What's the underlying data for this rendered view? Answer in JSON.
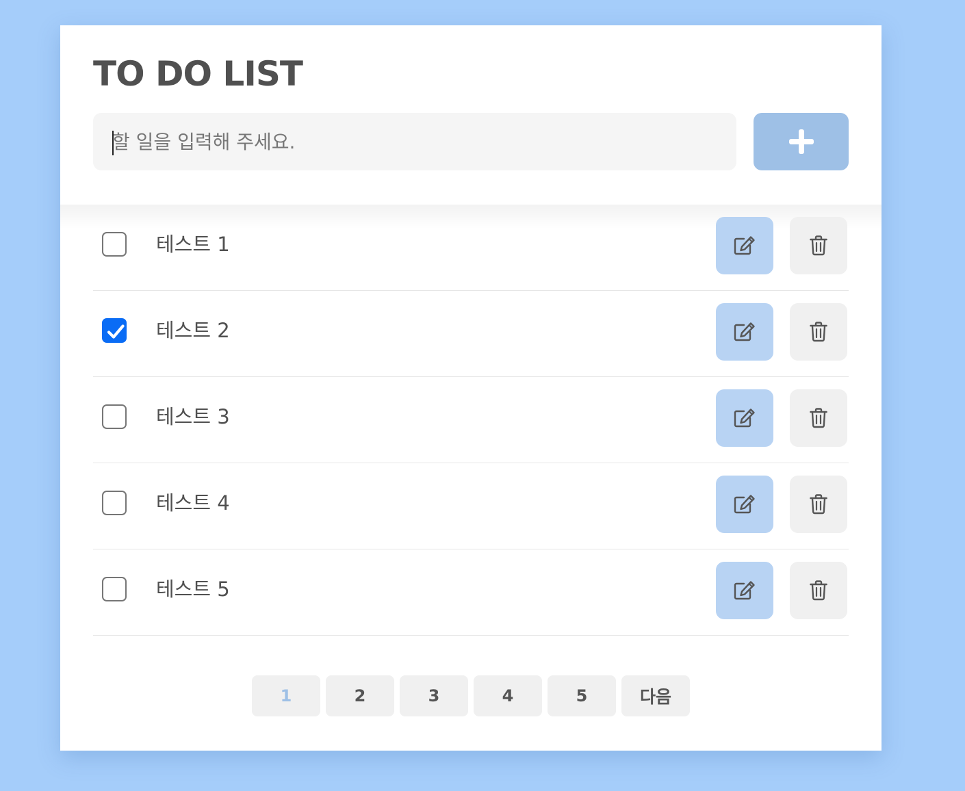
{
  "header": {
    "title": "TO DO LIST",
    "input_placeholder": "할 일을 입력해 주세요.",
    "input_value": "",
    "add_icon": "plus-icon"
  },
  "todos": [
    {
      "text": "테스트 1",
      "checked": false
    },
    {
      "text": "테스트 2",
      "checked": true
    },
    {
      "text": "테스트 3",
      "checked": false
    },
    {
      "text": "테스트 4",
      "checked": false
    },
    {
      "text": "테스트 5",
      "checked": false
    }
  ],
  "row_icons": {
    "edit": "edit-icon",
    "delete": "trash-icon"
  },
  "pagination": {
    "pages": [
      "1",
      "2",
      "3",
      "4",
      "5"
    ],
    "active_page": "1",
    "next_label": "다음"
  },
  "colors": {
    "background": "#a5cdfa",
    "accent": "#9ec0e6",
    "edit_button": "#b8d3f3",
    "checkbox_checked": "#0a6cf5"
  }
}
